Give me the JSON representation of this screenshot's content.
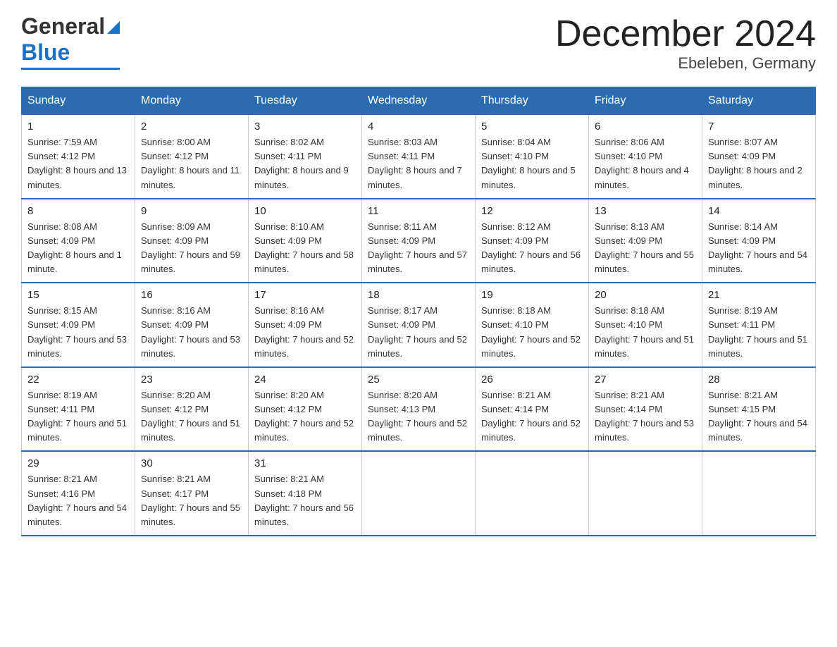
{
  "header": {
    "logo": {
      "line1": "General",
      "arrow": "▶",
      "line2": "Blue",
      "underline": true
    },
    "title": "December 2024",
    "subtitle": "Ebeleben, Germany"
  },
  "days_of_week": [
    "Sunday",
    "Monday",
    "Tuesday",
    "Wednesday",
    "Thursday",
    "Friday",
    "Saturday"
  ],
  "weeks": [
    [
      {
        "num": "1",
        "sunrise": "7:59 AM",
        "sunset": "4:12 PM",
        "daylight": "8 hours and 13 minutes."
      },
      {
        "num": "2",
        "sunrise": "8:00 AM",
        "sunset": "4:12 PM",
        "daylight": "8 hours and 11 minutes."
      },
      {
        "num": "3",
        "sunrise": "8:02 AM",
        "sunset": "4:11 PM",
        "daylight": "8 hours and 9 minutes."
      },
      {
        "num": "4",
        "sunrise": "8:03 AM",
        "sunset": "4:11 PM",
        "daylight": "8 hours and 7 minutes."
      },
      {
        "num": "5",
        "sunrise": "8:04 AM",
        "sunset": "4:10 PM",
        "daylight": "8 hours and 5 minutes."
      },
      {
        "num": "6",
        "sunrise": "8:06 AM",
        "sunset": "4:10 PM",
        "daylight": "8 hours and 4 minutes."
      },
      {
        "num": "7",
        "sunrise": "8:07 AM",
        "sunset": "4:09 PM",
        "daylight": "8 hours and 2 minutes."
      }
    ],
    [
      {
        "num": "8",
        "sunrise": "8:08 AM",
        "sunset": "4:09 PM",
        "daylight": "8 hours and 1 minute."
      },
      {
        "num": "9",
        "sunrise": "8:09 AM",
        "sunset": "4:09 PM",
        "daylight": "7 hours and 59 minutes."
      },
      {
        "num": "10",
        "sunrise": "8:10 AM",
        "sunset": "4:09 PM",
        "daylight": "7 hours and 58 minutes."
      },
      {
        "num": "11",
        "sunrise": "8:11 AM",
        "sunset": "4:09 PM",
        "daylight": "7 hours and 57 minutes."
      },
      {
        "num": "12",
        "sunrise": "8:12 AM",
        "sunset": "4:09 PM",
        "daylight": "7 hours and 56 minutes."
      },
      {
        "num": "13",
        "sunrise": "8:13 AM",
        "sunset": "4:09 PM",
        "daylight": "7 hours and 55 minutes."
      },
      {
        "num": "14",
        "sunrise": "8:14 AM",
        "sunset": "4:09 PM",
        "daylight": "7 hours and 54 minutes."
      }
    ],
    [
      {
        "num": "15",
        "sunrise": "8:15 AM",
        "sunset": "4:09 PM",
        "daylight": "7 hours and 53 minutes."
      },
      {
        "num": "16",
        "sunrise": "8:16 AM",
        "sunset": "4:09 PM",
        "daylight": "7 hours and 53 minutes."
      },
      {
        "num": "17",
        "sunrise": "8:16 AM",
        "sunset": "4:09 PM",
        "daylight": "7 hours and 52 minutes."
      },
      {
        "num": "18",
        "sunrise": "8:17 AM",
        "sunset": "4:09 PM",
        "daylight": "7 hours and 52 minutes."
      },
      {
        "num": "19",
        "sunrise": "8:18 AM",
        "sunset": "4:10 PM",
        "daylight": "7 hours and 52 minutes."
      },
      {
        "num": "20",
        "sunrise": "8:18 AM",
        "sunset": "4:10 PM",
        "daylight": "7 hours and 51 minutes."
      },
      {
        "num": "21",
        "sunrise": "8:19 AM",
        "sunset": "4:11 PM",
        "daylight": "7 hours and 51 minutes."
      }
    ],
    [
      {
        "num": "22",
        "sunrise": "8:19 AM",
        "sunset": "4:11 PM",
        "daylight": "7 hours and 51 minutes."
      },
      {
        "num": "23",
        "sunrise": "8:20 AM",
        "sunset": "4:12 PM",
        "daylight": "7 hours and 51 minutes."
      },
      {
        "num": "24",
        "sunrise": "8:20 AM",
        "sunset": "4:12 PM",
        "daylight": "7 hours and 52 minutes."
      },
      {
        "num": "25",
        "sunrise": "8:20 AM",
        "sunset": "4:13 PM",
        "daylight": "7 hours and 52 minutes."
      },
      {
        "num": "26",
        "sunrise": "8:21 AM",
        "sunset": "4:14 PM",
        "daylight": "7 hours and 52 minutes."
      },
      {
        "num": "27",
        "sunrise": "8:21 AM",
        "sunset": "4:14 PM",
        "daylight": "7 hours and 53 minutes."
      },
      {
        "num": "28",
        "sunrise": "8:21 AM",
        "sunset": "4:15 PM",
        "daylight": "7 hours and 54 minutes."
      }
    ],
    [
      {
        "num": "29",
        "sunrise": "8:21 AM",
        "sunset": "4:16 PM",
        "daylight": "7 hours and 54 minutes."
      },
      {
        "num": "30",
        "sunrise": "8:21 AM",
        "sunset": "4:17 PM",
        "daylight": "7 hours and 55 minutes."
      },
      {
        "num": "31",
        "sunrise": "8:21 AM",
        "sunset": "4:18 PM",
        "daylight": "7 hours and 56 minutes."
      },
      null,
      null,
      null,
      null
    ]
  ]
}
